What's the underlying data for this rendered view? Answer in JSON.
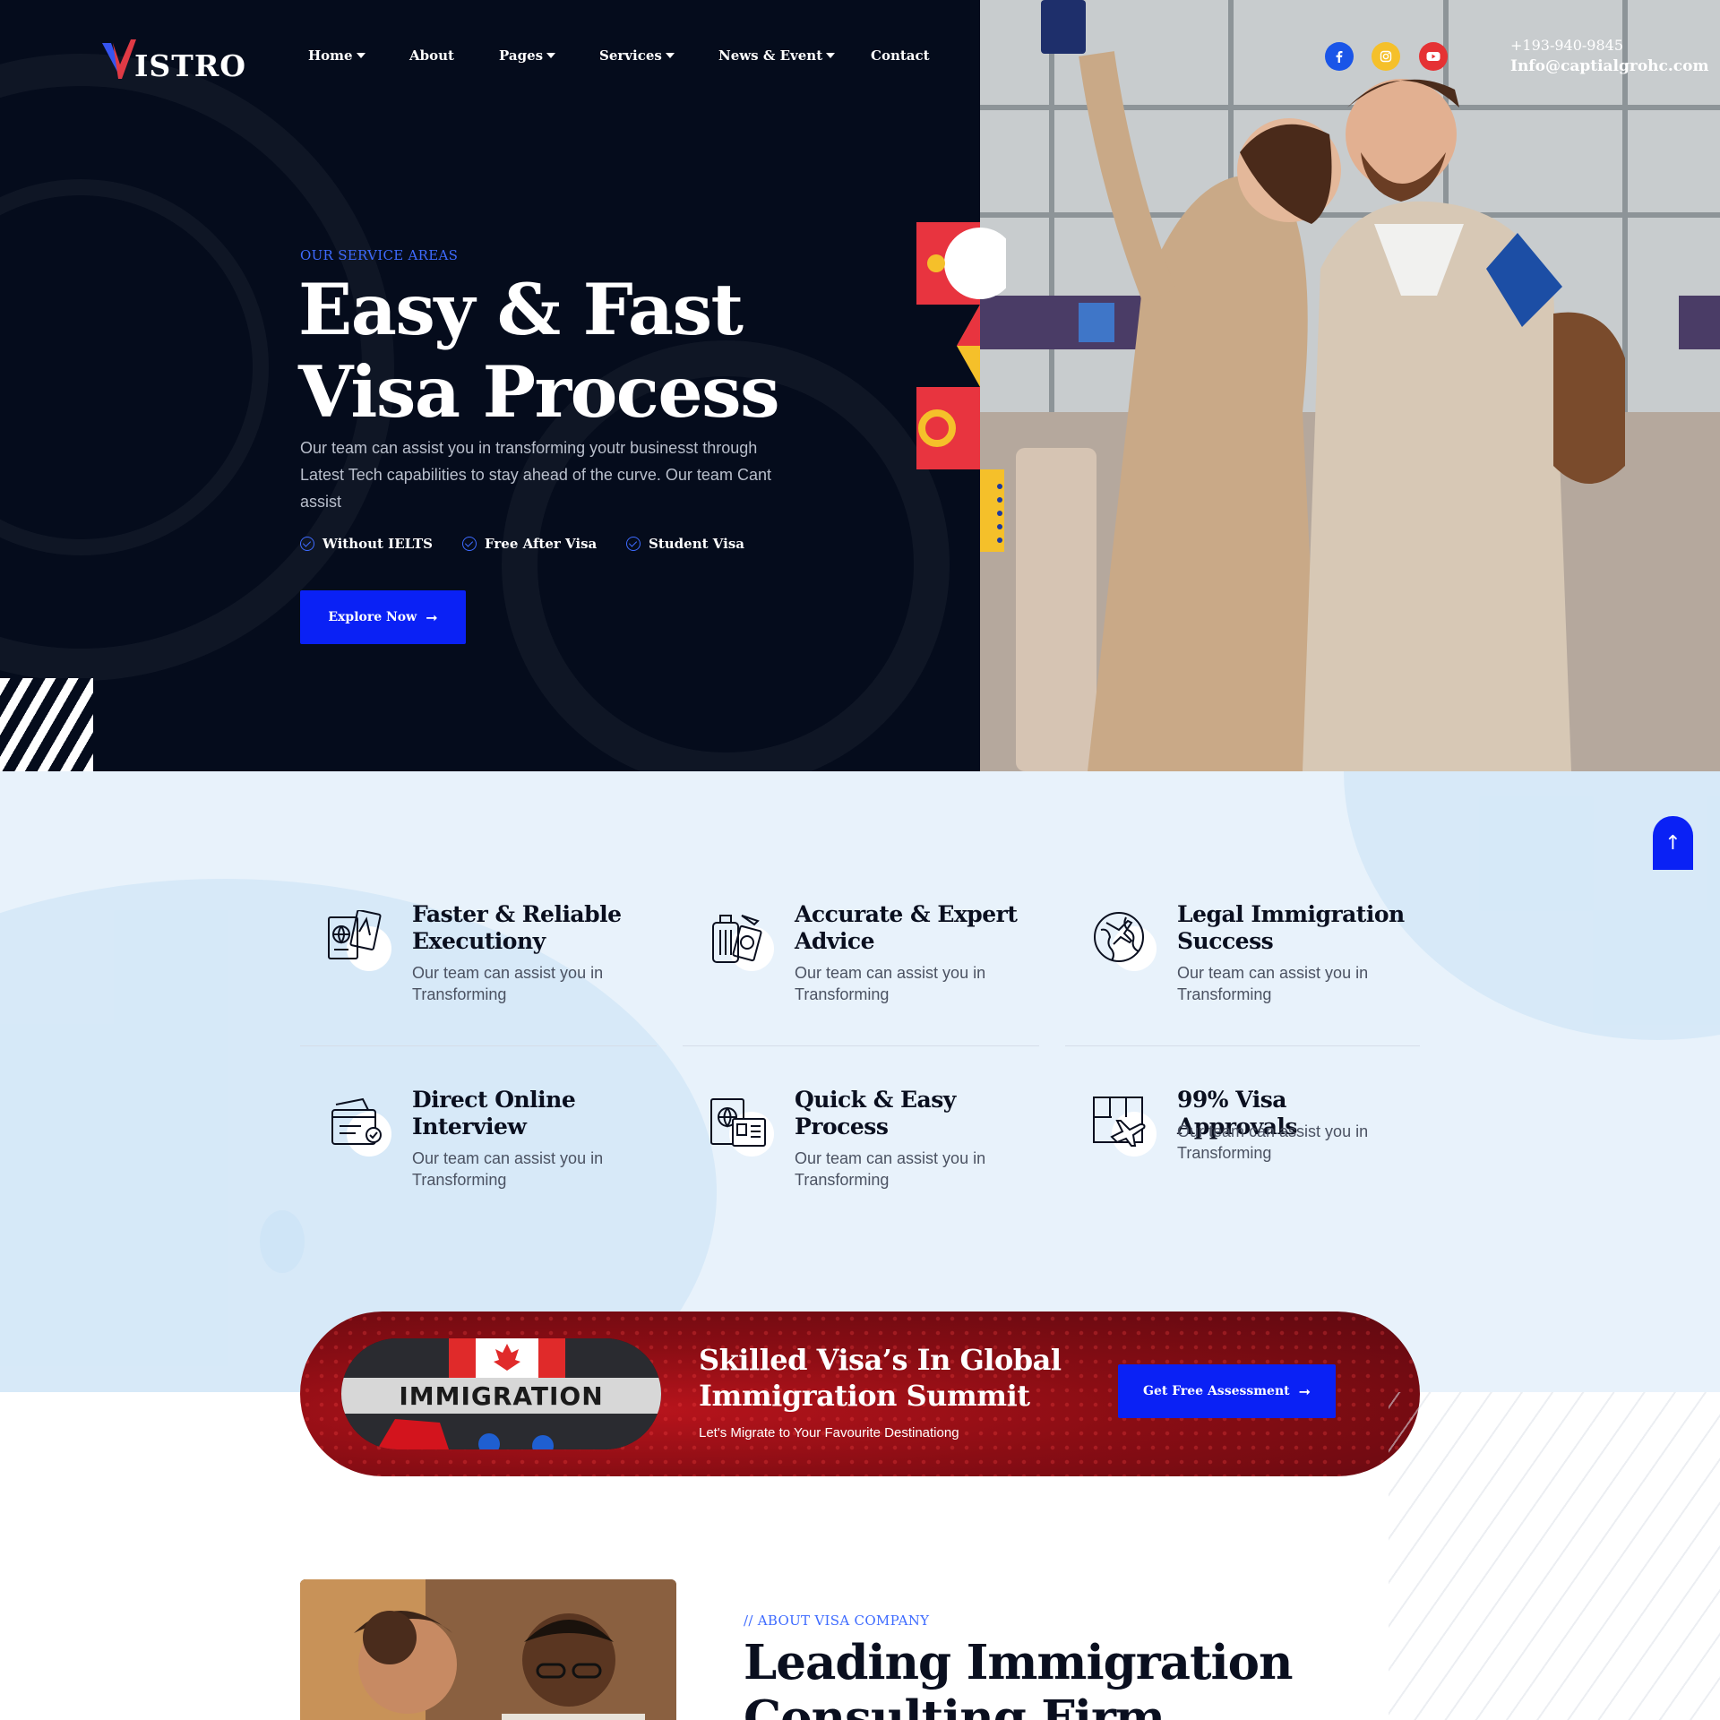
{
  "brand": {
    "logo_text": "ISTRO"
  },
  "nav": {
    "items": [
      {
        "label": "Home",
        "dropdown": true
      },
      {
        "label": "About",
        "dropdown": false
      },
      {
        "label": "Pages",
        "dropdown": true
      },
      {
        "label": "Services",
        "dropdown": true
      },
      {
        "label": "News & Event",
        "dropdown": true
      },
      {
        "label": "Contact",
        "dropdown": false
      }
    ]
  },
  "social": [
    {
      "icon": "facebook-icon",
      "color": "#1a55e8"
    },
    {
      "icon": "instagram-icon",
      "color": "#f5c02a"
    },
    {
      "icon": "youtube-icon",
      "color": "#e53234"
    }
  ],
  "contact": {
    "phone": "+193-940-9845",
    "email": "Info@captialgrohc.com"
  },
  "hero": {
    "eyebrow": "OUR SERVICE AREAS",
    "title_line1": "Easy & Fast",
    "title_line2": "Visa Process",
    "description": "Our team can assist you in transforming youtr businesst through Latest Tech capabilities to stay ahead of the curve. Our team Cant assist",
    "features": [
      "Without IELTS",
      "Free After Visa",
      "Student Visa"
    ],
    "cta_label": "Explore Now"
  },
  "services": [
    {
      "title": "Faster & Reliable Executiony",
      "description": "Our team can assist you in Transforming",
      "icon": "passport-docs-icon"
    },
    {
      "title": "Accurate & Expert Advice",
      "description": "Our team can assist you in Transforming",
      "icon": "luggage-passport-icon"
    },
    {
      "title": "Legal Immigration Success",
      "description": "Our team can assist you in Transforming",
      "icon": "globe-plane-icon"
    },
    {
      "title": "Direct Online Interview",
      "description": "Our team can assist you in Transforming",
      "icon": "approved-documents-icon"
    },
    {
      "title": "Quick & Easy Process",
      "description": "Our team can assist you in Transforming",
      "icon": "passport-id-icon"
    },
    {
      "title": "99% Visa Approvals",
      "description": "Our team can assist you in Transforming",
      "icon": "map-plane-icon"
    }
  ],
  "banner": {
    "image_text": "IMMIGRATION",
    "title_line1": "Skilled Visa’s In Global",
    "title_line2": "Immigration Summit",
    "subtitle": "Let's Migrate to Your Favourite Destinationg",
    "cta_label": "Get Free Assessment"
  },
  "about": {
    "eyebrow": "// ABOUT VISA COMPANY",
    "title_line1": "Leading Immigration",
    "title_line2": "Consulting Firm"
  },
  "colors": {
    "accent": "#0a21f5",
    "eyebrow": "#3e6bff",
    "hero_bg": "#050c1c",
    "banner_red": "#8a0d14",
    "services_bg": "#e8f2fb"
  }
}
